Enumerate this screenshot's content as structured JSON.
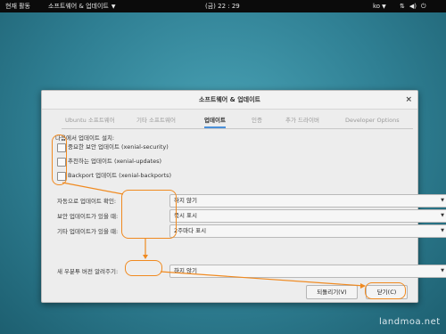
{
  "topbar": {
    "activities": "현재 활동",
    "app_name": "소프트웨어 & 업데이트",
    "app_caret": "▼",
    "clock": "(금) 22 : 29",
    "lang": "ko",
    "lang_caret": "▼",
    "icons": [
      "network-icon",
      "volume-icon",
      "power-icon"
    ]
  },
  "dialog": {
    "title": "소프트웨어 & 업데이트",
    "close": "×",
    "tabs": [
      "Ubuntu 소프트웨어",
      "기타 소프트웨어",
      "업데이트",
      "인증",
      "추가 드라이버",
      "Developer Options"
    ],
    "active_tab_index": 2,
    "install_from_label": "다음에서 업데이트 설치:",
    "checkboxes": [
      {
        "label": "중요한 보안 업데이트 (xenial-security)",
        "checked": false
      },
      {
        "label": "추천하는 업데이트 (xenial-updates)",
        "checked": false
      },
      {
        "label": "Backport 업데이트 (xenial-backports)",
        "checked": false
      }
    ],
    "settings": [
      {
        "label": "자동으로 업데이트 확인:",
        "value": "하지 않기"
      },
      {
        "label": "보안 업데이트가 있을 때:",
        "value": "즉시 표시"
      },
      {
        "label": "기타 업데이트가 있을 때:",
        "value": "2주마다 표시"
      }
    ],
    "release_notify": {
      "label": "새 우분투 버전 알려주기:",
      "value": "하지 않기"
    },
    "dropdown_arrow": "▼",
    "buttons": {
      "revert": "되돌리기(V)",
      "close": "닫기(C)"
    }
  },
  "watermark": "landmoa.net",
  "colors": {
    "annotation": "#f08a20",
    "active_tab": "#4a90d9",
    "topbar": "#0b0b0b"
  }
}
